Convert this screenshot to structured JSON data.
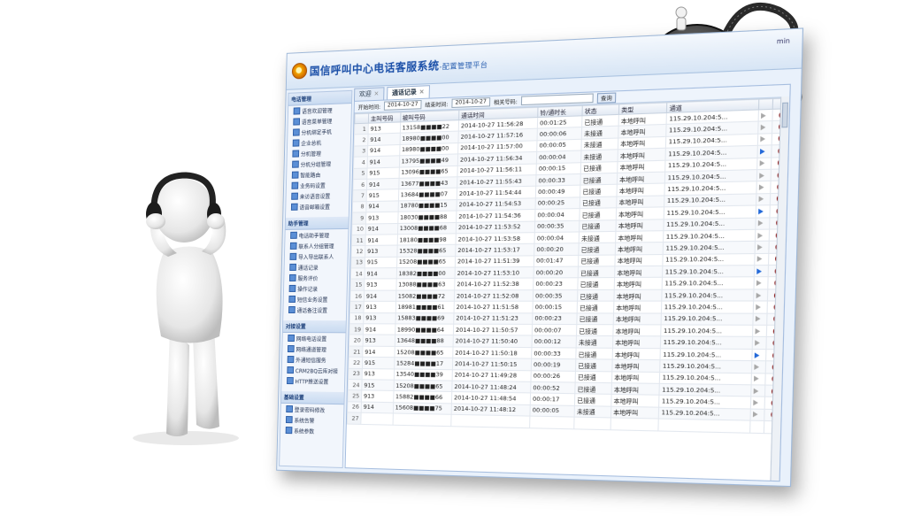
{
  "app": {
    "title": "国信呼叫中心电话客服系统",
    "subtitle": "-配置管理平台",
    "user": "min"
  },
  "tabs": [
    {
      "label": "欢迎"
    },
    {
      "label": "通话记录"
    }
  ],
  "filter": {
    "start_label": "开始时间:",
    "start_value": "2014-10-27",
    "end_label": "结束时间:",
    "end_value": "2014-10-27",
    "related_label": "相关号码:",
    "query_label": "查询"
  },
  "sidebar": {
    "groups": [
      {
        "title": "电话管理",
        "items": [
          "语音欢迎管理",
          "语音菜单管理",
          "分机绑定手机",
          "企业总机",
          "分机管理",
          "分机分组管理",
          "智能路由",
          "业务码设置",
          "来访语音设置",
          "语音邮箱设置"
        ]
      },
      {
        "title": "助手管理",
        "items": [
          "电话助手管理",
          "联系人分组管理",
          "导入导出联系人",
          "通话记录",
          "服务评价",
          "操作记录",
          "短信业务设置",
          "通话备注设置"
        ]
      },
      {
        "title": "对接设置",
        "items": [
          "网络电话设置",
          "网络通道管理",
          "外通短信服务",
          "CRM2BQ云库对接",
          "HTTP推送设置"
        ]
      },
      {
        "title": "基础设置",
        "items": [
          "登录密码修改",
          "系统告警",
          "系统参数"
        ]
      }
    ]
  },
  "table": {
    "headers": [
      "",
      "主叫号码",
      "被叫号码",
      "通话时间",
      "铃/通时长",
      "状态",
      "类型",
      "通道",
      "",
      ""
    ],
    "rows": [
      [
        "1",
        "913",
        "13158■■■■22",
        "2014-10-27 11:56:28",
        "00:01:25",
        "已接通",
        "本地呼叫",
        "115.29.10.204:5..."
      ],
      [
        "2",
        "914",
        "18980■■■■00",
        "2014-10-27 11:57:16",
        "00:00:06",
        "未接通",
        "本地呼叫",
        "115.29.10.204:5..."
      ],
      [
        "3",
        "914",
        "18980■■■■00",
        "2014-10-27 11:57:00",
        "00:00:05",
        "未接通",
        "本地呼叫",
        "115.29.10.204:5..."
      ],
      [
        "4",
        "914",
        "13795■■■■49",
        "2014-10-27 11:56:34",
        "00:00:04",
        "未接通",
        "本地呼叫",
        "115.29.10.204:5..."
      ],
      [
        "5",
        "915",
        "13096■■■■65",
        "2014-10-27 11:56:11",
        "00:00:15",
        "已接通",
        "本地呼叫",
        "115.29.10.204:5..."
      ],
      [
        "6",
        "914",
        "13677■■■■43",
        "2014-10-27 11:55:43",
        "00:00:33",
        "已接通",
        "本地呼叫",
        "115.29.10.204:5..."
      ],
      [
        "7",
        "915",
        "13684■■■■07",
        "2014-10-27 11:54:44",
        "00:00:49",
        "已接通",
        "本地呼叫",
        "115.29.10.204:5..."
      ],
      [
        "8",
        "914",
        "18780■■■■15",
        "2014-10-27 11:54:53",
        "00:00:25",
        "已接通",
        "本地呼叫",
        "115.29.10.204:5..."
      ],
      [
        "9",
        "913",
        "18030■■■■88",
        "2014-10-27 11:54:36",
        "00:00:04",
        "已接通",
        "本地呼叫",
        "115.29.10.204:5..."
      ],
      [
        "10",
        "914",
        "13008■■■■68",
        "2014-10-27 11:53:52",
        "00:00:35",
        "已接通",
        "本地呼叫",
        "115.29.10.204:5..."
      ],
      [
        "11",
        "914",
        "18180■■■■98",
        "2014-10-27 11:53:58",
        "00:00:04",
        "未接通",
        "本地呼叫",
        "115.29.10.204:5..."
      ],
      [
        "12",
        "913",
        "15328■■■■65",
        "2014-10-27 11:53:17",
        "00:00:20",
        "已接通",
        "本地呼叫",
        "115.29.10.204:5..."
      ],
      [
        "13",
        "915",
        "15208■■■■65",
        "2014-10-27 11:51:39",
        "00:01:47",
        "已接通",
        "本地呼叫",
        "115.29.10.204:5..."
      ],
      [
        "14",
        "914",
        "18382■■■■00",
        "2014-10-27 11:53:10",
        "00:00:20",
        "已接通",
        "本地呼叫",
        "115.29.10.204:5..."
      ],
      [
        "15",
        "913",
        "13088■■■■63",
        "2014-10-27 11:52:38",
        "00:00:23",
        "已接通",
        "本地呼叫",
        "115.29.10.204:5..."
      ],
      [
        "16",
        "914",
        "15082■■■■72",
        "2014-10-27 11:52:08",
        "00:00:35",
        "已接通",
        "本地呼叫",
        "115.29.10.204:5..."
      ],
      [
        "17",
        "913",
        "18981■■■■61",
        "2014-10-27 11:51:58",
        "00:00:15",
        "已接通",
        "本地呼叫",
        "115.29.10.204:5..."
      ],
      [
        "18",
        "913",
        "15883■■■■69",
        "2014-10-27 11:51:23",
        "00:00:23",
        "已接通",
        "本地呼叫",
        "115.29.10.204:5..."
      ],
      [
        "19",
        "914",
        "18990■■■■64",
        "2014-10-27 11:50:57",
        "00:00:07",
        "已接通",
        "本地呼叫",
        "115.29.10.204:5..."
      ],
      [
        "20",
        "913",
        "13648■■■■88",
        "2014-10-27 11:50:40",
        "00:00:12",
        "未接通",
        "本地呼叫",
        "115.29.10.204:5..."
      ],
      [
        "21",
        "914",
        "15208■■■■65",
        "2014-10-27 11:50:18",
        "00:00:33",
        "已接通",
        "本地呼叫",
        "115.29.10.204:5..."
      ],
      [
        "22",
        "915",
        "15284■■■■17",
        "2014-10-27 11:50:15",
        "00:00:19",
        "已接通",
        "本地呼叫",
        "115.29.10.204:5..."
      ],
      [
        "23",
        "913",
        "13540■■■■39",
        "2014-10-27 11:49:28",
        "00:00:26",
        "已接通",
        "本地呼叫",
        "115.29.10.204:5..."
      ],
      [
        "24",
        "915",
        "15208■■■■65",
        "2014-10-27 11:48:24",
        "00:00:52",
        "已接通",
        "本地呼叫",
        "115.29.10.204:5..."
      ],
      [
        "25",
        "913",
        "15882■■■■66",
        "2014-10-27 11:48:54",
        "00:00:17",
        "已接通",
        "本地呼叫",
        "115.29.10.204:5..."
      ],
      [
        "26",
        "914",
        "15608■■■■75",
        "2014-10-27 11:48:12",
        "00:00:05",
        "未接通",
        "本地呼叫",
        "115.29.10.204:5..."
      ],
      [
        "27",
        "",
        "",
        "",
        "",
        "",
        "",
        ""
      ]
    ],
    "play_grey_rows": [
      1,
      2,
      3,
      5,
      6,
      7,
      8,
      10,
      11,
      12,
      13,
      15,
      16,
      17,
      18,
      19,
      20,
      22,
      23,
      24,
      25,
      26
    ]
  }
}
